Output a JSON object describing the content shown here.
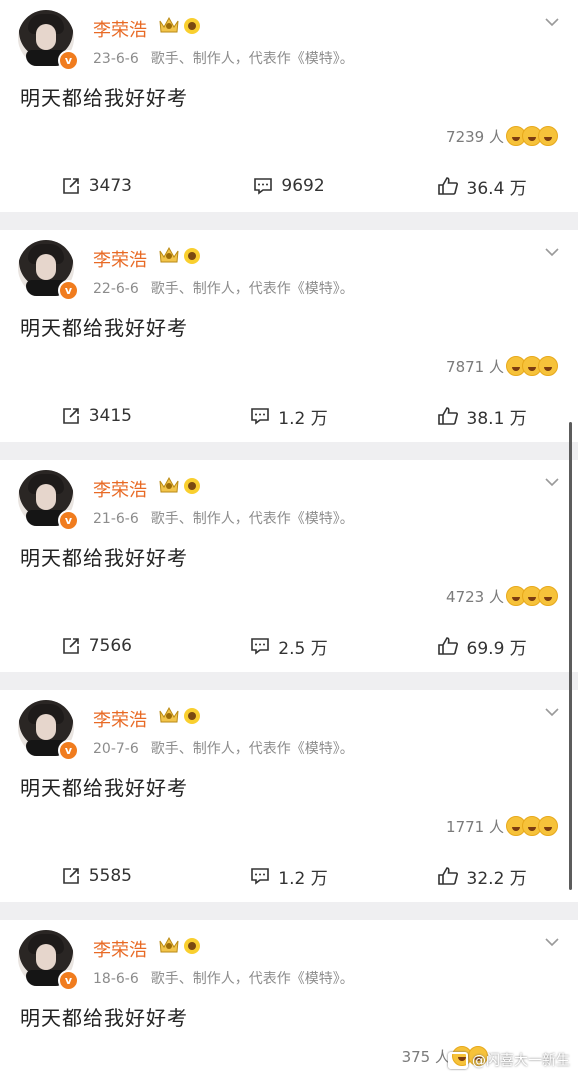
{
  "posts": [
    {
      "name": "李荣浩",
      "date": "23-6-6",
      "bio": "歌手、制作人，代表作《模特》。",
      "text": "明天都给我好好考",
      "reaction_count": "7239 人",
      "shares": "3473",
      "comments": "9692",
      "likes": "36.4 万"
    },
    {
      "name": "李荣浩",
      "date": "22-6-6",
      "bio": "歌手、制作人，代表作《模特》。",
      "text": "明天都给我好好考",
      "reaction_count": "7871 人",
      "shares": "3415",
      "comments": "1.2 万",
      "likes": "38.1 万"
    },
    {
      "name": "李荣浩",
      "date": "21-6-6",
      "bio": "歌手、制作人，代表作《模特》。",
      "text": "明天都给我好好考",
      "reaction_count": "4723 人",
      "shares": "7566",
      "comments": "2.5 万",
      "likes": "69.9 万"
    },
    {
      "name": "李荣浩",
      "date": "20-7-6",
      "bio": "歌手、制作人，代表作《模特》。",
      "text": "明天都给我好好考",
      "reaction_count": "1771 人",
      "shares": "5585",
      "comments": "1.2 万",
      "likes": "32.2 万"
    },
    {
      "name": "李荣浩",
      "date": "18-6-6",
      "bio": "歌手、制作人，代表作《模特》。",
      "text": "明天都给我好好考",
      "reaction_count": "375 人"
    }
  ],
  "watermark": "@闪喜大一新生",
  "icons": {
    "share": "share-icon",
    "comment": "comment-icon",
    "like": "thumbs-up-icon",
    "more": "chevron-down-icon",
    "verified": "verified-v-icon"
  },
  "colors": {
    "name": "#e86a25",
    "badge": "#f07c1e",
    "background": "#efeff1"
  }
}
